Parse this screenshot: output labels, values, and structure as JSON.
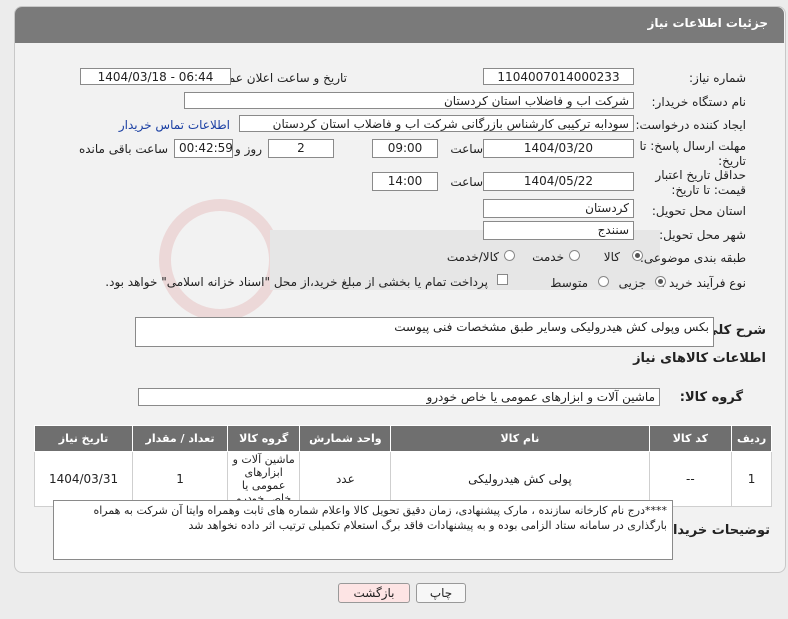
{
  "header": {
    "title": "جزئیات اطلاعات نیاز"
  },
  "labels": {
    "need_number": "شماره نیاز:",
    "announce_datetime": "تاریخ و ساعت اعلان عمومی:",
    "buyer_org": "نام دستگاه خریدار:",
    "requester": "ایجاد کننده درخواست:",
    "buyer_contact_link": "اطلاعات تماس خریدار",
    "reply_deadline": "مهلت ارسال پاسخ: تا تاریخ:",
    "hour": "ساعت",
    "day_and": "روز و",
    "time_remaining": "ساعت باقی مانده",
    "price_validity": "حداقل تاریخ اعتبار قیمت: تا تاریخ:",
    "delivery_province": "استان محل تحویل:",
    "delivery_city": "شهر محل تحویل:",
    "category": "طبقه بندی موضوعی:",
    "process_type": "نوع فرآیند خرید :",
    "general_desc": "شرح کلی نیاز:",
    "goods_info": "اطلاعات کالاهای نیاز",
    "goods_group": "گروه کالا:",
    "buyer_notes": "توضیحات خریدار:"
  },
  "values": {
    "need_number": "1104007014000233",
    "announce_datetime": "1404/03/18 - 06:44",
    "buyer_org": "شرکت اب و فاضلاب استان کردستان",
    "requester": "سودابه ترکیبی کارشناس بازرگانی شرکت اب و فاضلاب استان کردستان",
    "reply_date": "1404/03/20",
    "reply_time": "09:00",
    "reply_days": "2",
    "reply_remaining": "00:42:59",
    "price_date": "1404/05/22",
    "price_time": "14:00",
    "delivery_province": "کردستان",
    "delivery_city": "سنندج",
    "general_desc": "بکس وپولی کش هیدرولیکی    وسایر طبق مشخصات فنی پیوست",
    "goods_group": "ماشین آلات و ابزارهای عمومی یا خاص خودرو",
    "buyer_notes": "****درج نام کارخانه سازنده ، مارک پیشنهادی، زمان دقیق تحویل کالا واعلام شماره های ثابت وهمراه وایتا آن شرکت به همراه بارگذاری در سامانه ستاد الزامی بوده و به پیشنهادات فاقد برگ استعلام تکمیلی ترتیب اثر داده نخواهد شد"
  },
  "category_options": [
    {
      "label": "کالا",
      "selected": true
    },
    {
      "label": "خدمت",
      "selected": false
    },
    {
      "label": "کالا/خدمت",
      "selected": false
    }
  ],
  "process_options": [
    {
      "label": "جزیی",
      "selected": true
    },
    {
      "label": "متوسط",
      "selected": false
    }
  ],
  "payment_note": "پرداخت تمام یا بخشی از مبلغ خرید،از محل \"اسناد خزانه اسلامی\" خواهد بود.",
  "table": {
    "headers": [
      "ردیف",
      "کد کالا",
      "نام کالا",
      "واحد شمارش",
      "گروه کالا",
      "تعداد / مقدار",
      "تاریخ نیاز"
    ],
    "rows": [
      [
        "1",
        "--",
        "پولی کش هیدرولیکی",
        "عدد",
        "ماشین آلات و ابزارهای عمومی یا خاص خودرو",
        "1",
        "1404/03/31"
      ]
    ]
  },
  "buttons": {
    "print": "چاپ",
    "back": "بازگشت"
  },
  "colors": {
    "header_bg": "#7a7a7a",
    "link": "#1a3fa3",
    "back_button": "#fde4e4"
  }
}
